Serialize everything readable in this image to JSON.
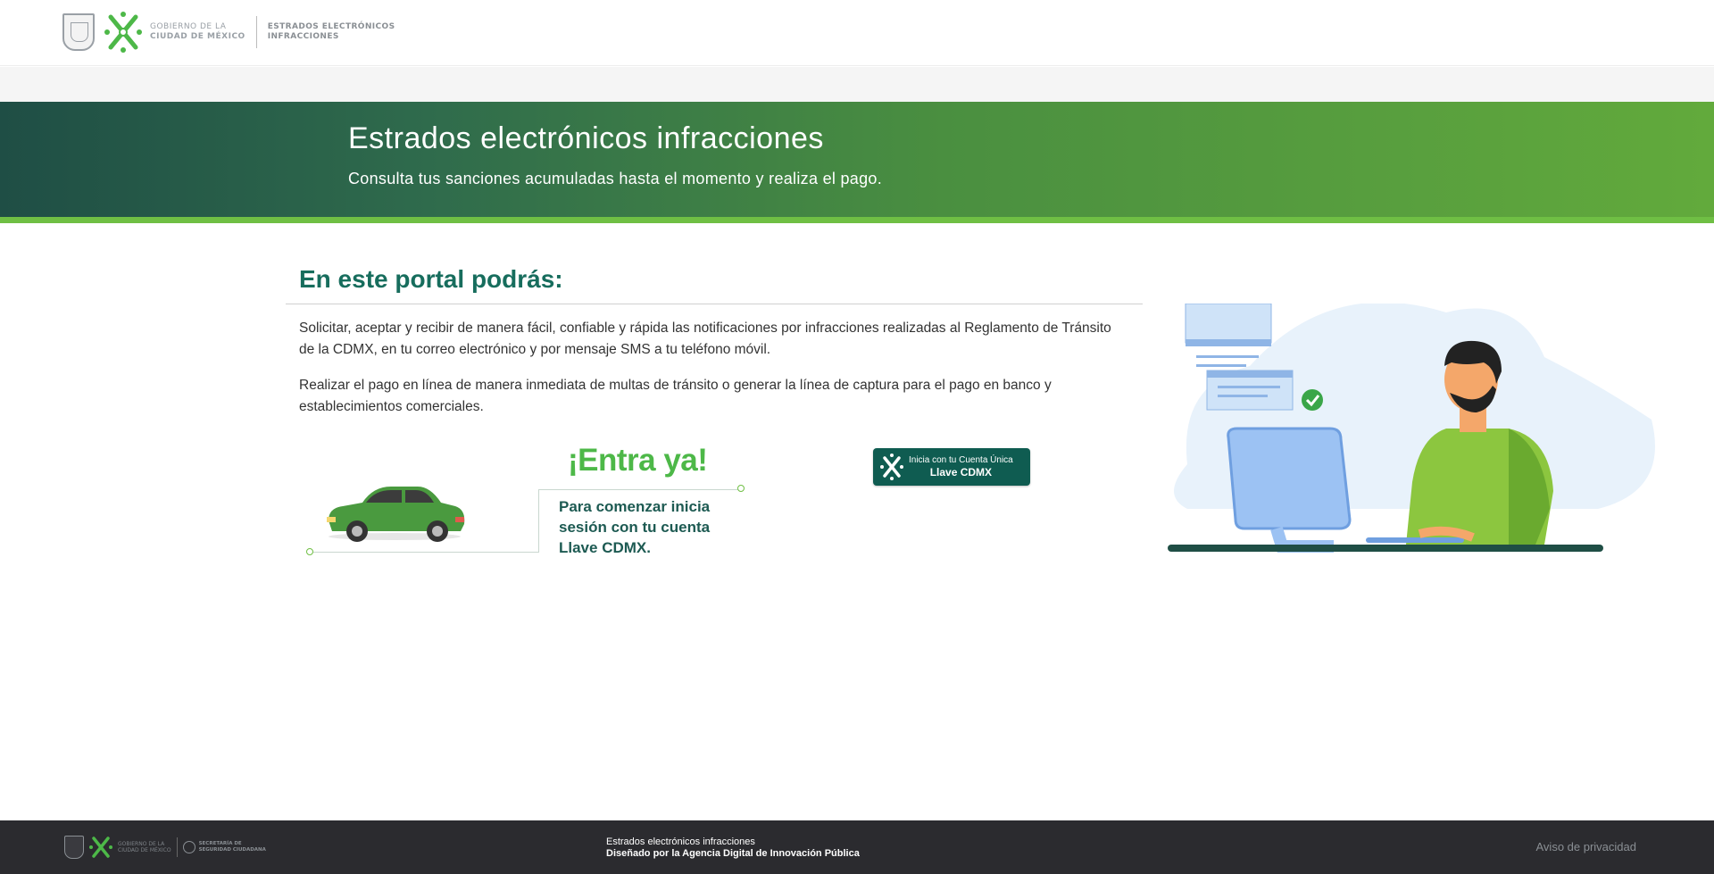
{
  "header": {
    "gov_line1": "GOBIERNO DE LA",
    "gov_line2": "CIUDAD DE MÉXICO",
    "site_line1": "ESTRADOS ELECTRÓNICOS",
    "site_line2": "INFRACCIONES"
  },
  "hero": {
    "title": "Estrados electrónicos infracciones",
    "subtitle": "Consulta tus sanciones acumuladas hasta el momento y realiza el pago."
  },
  "main": {
    "section_title": "En este portal podrás:",
    "paragraph1": "Solicitar, aceptar y recibir de manera fácil, confiable y rápida las notificaciones por infracciones realizadas al Reglamento de Tránsito de la CDMX, en tu correo electrónico y por mensaje SMS a tu teléfono móvil.",
    "paragraph2": "Realizar el pago en línea de manera inmediata de multas de tránsito o generar la línea de captura para el pago en banco y establecimientos comerciales."
  },
  "promo": {
    "headline": "¡Entra ya!",
    "text": "Para comenzar inicia sesión con tu cuenta Llave CDMX."
  },
  "login_button": {
    "line1": "Inicia con tu Cuenta Única",
    "line2": "Llave CDMX"
  },
  "footer": {
    "gov_line1": "GOBIERNO DE LA",
    "gov_line2": "CIUDAD DE MÉXICO",
    "ssc_line1": "SECRETARÍA DE",
    "ssc_line2": "SEGURIDAD CIUDADANA",
    "center_line1": "Estrados electrónicos infracciones",
    "center_line2": "Diseñado por la Agencia Digital de Innovación Pública",
    "privacy_link": "Aviso de privacidad"
  },
  "colors": {
    "brand_green": "#4db848",
    "dark_teal": "#176d5d",
    "button_bg": "#0f5c51",
    "footer_bg": "#2b2b2f"
  }
}
